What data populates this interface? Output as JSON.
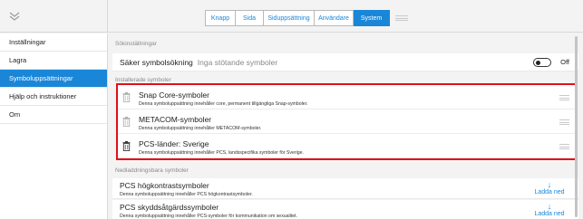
{
  "topbar": {
    "collapse_icon": "double-chevron-down-icon",
    "tabs": [
      {
        "label": "Knapp",
        "active": false
      },
      {
        "label": "Sida",
        "active": false
      },
      {
        "label": "Siduppsättning",
        "active": false
      },
      {
        "label": "Användare",
        "active": false
      },
      {
        "label": "System",
        "active": true
      }
    ],
    "drag_icon": "drag-handle-icon"
  },
  "sidebar": {
    "items": [
      {
        "label": "Inställningar",
        "active": false
      },
      {
        "label": "Lagra",
        "active": false
      },
      {
        "label": "Symboluppsättningar",
        "active": true
      },
      {
        "label": "Hjälp och instruktioner",
        "active": false
      },
      {
        "label": "Om",
        "active": false
      }
    ]
  },
  "search_settings": {
    "header": "Sökinställningar",
    "label": "Säker symbolsökning",
    "value": "Inga stötande symboler",
    "toggle_label": "Off",
    "toggle_on": false
  },
  "installed": {
    "header": "Installerade symboler",
    "items": [
      {
        "title": "Snap Core-symboler",
        "desc": "Denna symboluppsättning innehåller core, permanent tillgängliga Snap-symboler."
      },
      {
        "title": "METACOM-symboler",
        "desc": "Denna symboluppsättning innehåller METACOM-symboler."
      },
      {
        "title": "PCS-länder: Sverige",
        "desc": "Denna symboluppsättning innehåller PCS, landsspecifika symboler för Sverige."
      }
    ]
  },
  "downloadable": {
    "header": "Nedladdningsbara symboler",
    "download_label": "Ladda ned",
    "items": [
      {
        "title": "PCS högkontrastsymboler",
        "desc": "Denna symboluppsättning innehåller PCS högkontrastsymboler."
      },
      {
        "title": "PCS skyddsåtgärdssymboler",
        "desc": "Denna symboluppsättning innehåller PCS-symboler för kommunikation om sexualitet."
      }
    ]
  },
  "colors": {
    "accent": "#1a86d8",
    "highlight_border": "#e0101a"
  }
}
